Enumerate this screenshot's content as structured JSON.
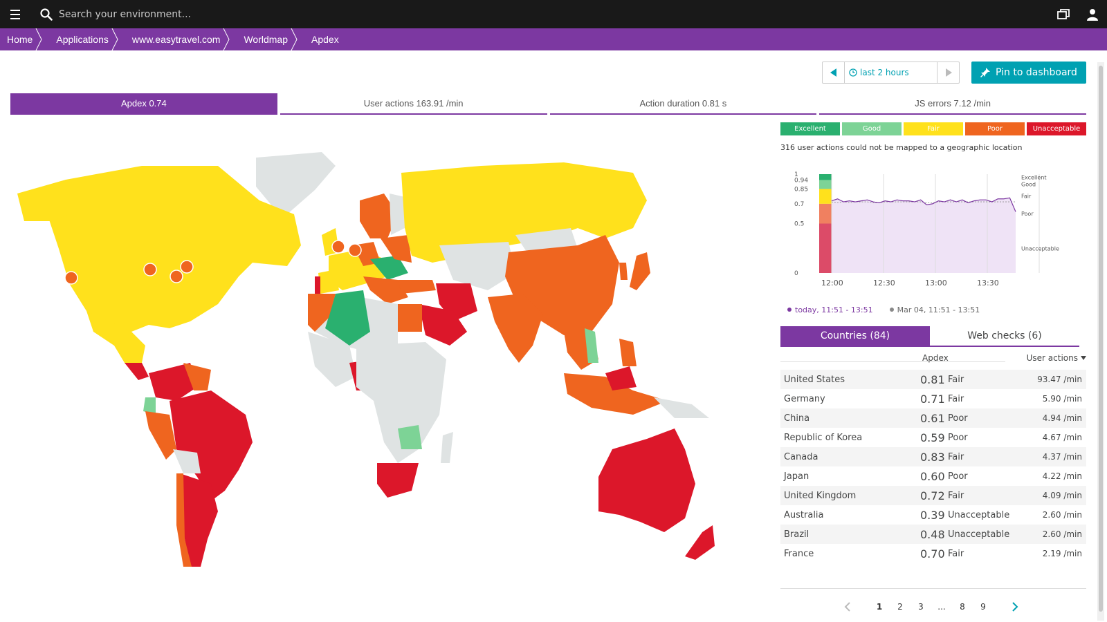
{
  "topbar": {
    "search_placeholder": "Search your environment...",
    "icons": [
      "menu-icon",
      "search-icon",
      "windows-icon",
      "user-icon"
    ]
  },
  "breadcrumb": [
    "Home",
    "Applications",
    "www.easytravel.com",
    "Worldmap",
    "Apdex"
  ],
  "timeframe": {
    "label": "last 2 hours"
  },
  "pin_button": {
    "label": "Pin to dashboard"
  },
  "metric_tabs": [
    {
      "label": "Apdex 0.74",
      "active": true
    },
    {
      "label": "User actions 163.91 /min",
      "active": false
    },
    {
      "label": "Action duration 0.81 s",
      "active": false
    },
    {
      "label": "JS errors 7.12 /min",
      "active": false
    }
  ],
  "legend": [
    {
      "label": "Excellent",
      "color": "#2ab06f"
    },
    {
      "label": "Good",
      "color": "#7dd396"
    },
    {
      "label": "Fair",
      "color": "#ffe11c"
    },
    {
      "label": "Poor",
      "color": "#ef651f"
    },
    {
      "label": "Unacceptable",
      "color": "#dc172a"
    }
  ],
  "unmapped_note": "316 user actions could not be mapped to a geographic location",
  "chart_data": {
    "type": "line",
    "x_ticks": [
      "12:00",
      "12:30",
      "13:00",
      "13:30"
    ],
    "y_ticks": [
      "0",
      "0.5",
      "0.7",
      "0.85",
      "0.94",
      "1"
    ],
    "ylim": [
      0,
      1
    ],
    "band_labels": [
      "Excellent",
      "Good",
      "Fair",
      "Poor",
      "Unacceptable"
    ],
    "series": [
      {
        "name": "today, 11:51 - 13:51",
        "color": "#7c38a1",
        "values": [
          0.73,
          0.75,
          0.72,
          0.73,
          0.72,
          0.73,
          0.74,
          0.72,
          0.71,
          0.73,
          0.72,
          0.74,
          0.73,
          0.73,
          0.72,
          0.74,
          0.69,
          0.7,
          0.73,
          0.72,
          0.74,
          0.72,
          0.74,
          0.71,
          0.73,
          0.74,
          0.74,
          0.72,
          0.75,
          0.75,
          0.76,
          0.62
        ]
      },
      {
        "name": "Mar 04, 11:51 - 13:51",
        "color": "#888888",
        "values": [
          0.72,
          0.71,
          0.72,
          0.71,
          0.72,
          0.72,
          0.72,
          0.71,
          0.71,
          0.72,
          0.72,
          0.72,
          0.72,
          0.72,
          0.72,
          0.72,
          0.71,
          0.71,
          0.72,
          0.72,
          0.72,
          0.72,
          0.72,
          0.72,
          0.72,
          0.72,
          0.72,
          0.72,
          0.72,
          0.72,
          0.72,
          0.72
        ]
      }
    ]
  },
  "chart_legend": {
    "today": "today, 11:51 - 13:51",
    "previous": "Mar 04, 11:51 - 13:51"
  },
  "list_tabs": [
    {
      "label": "Countries (84)",
      "active": true
    },
    {
      "label": "Web checks (6)",
      "active": false
    }
  ],
  "table": {
    "col_apdex": "Apdex",
    "col_actions": "User actions",
    "rows": [
      {
        "country": "United States",
        "score": "0.81",
        "rating": "Fair",
        "actions": "93.47 /min"
      },
      {
        "country": "Germany",
        "score": "0.71",
        "rating": "Fair",
        "actions": "5.90 /min"
      },
      {
        "country": "China",
        "score": "0.61",
        "rating": "Poor",
        "actions": "4.94 /min"
      },
      {
        "country": "Republic of Korea",
        "score": "0.59",
        "rating": "Poor",
        "actions": "4.67 /min"
      },
      {
        "country": "Canada",
        "score": "0.83",
        "rating": "Fair",
        "actions": "4.37 /min"
      },
      {
        "country": "Japan",
        "score": "0.60",
        "rating": "Poor",
        "actions": "4.22 /min"
      },
      {
        "country": "United Kingdom",
        "score": "0.72",
        "rating": "Fair",
        "actions": "4.09 /min"
      },
      {
        "country": "Australia",
        "score": "0.39",
        "rating": "Unacceptable",
        "actions": "2.60 /min"
      },
      {
        "country": "Brazil",
        "score": "0.48",
        "rating": "Unacceptable",
        "actions": "2.60 /min"
      },
      {
        "country": "France",
        "score": "0.70",
        "rating": "Fair",
        "actions": "2.19 /min"
      }
    ]
  },
  "pager": {
    "pages": [
      "1",
      "2",
      "3",
      "...",
      "8",
      "9"
    ],
    "current": "1"
  },
  "colors": {
    "brand": "#7c38a1",
    "accent": "#00a1b2",
    "topbar": "#191919"
  }
}
